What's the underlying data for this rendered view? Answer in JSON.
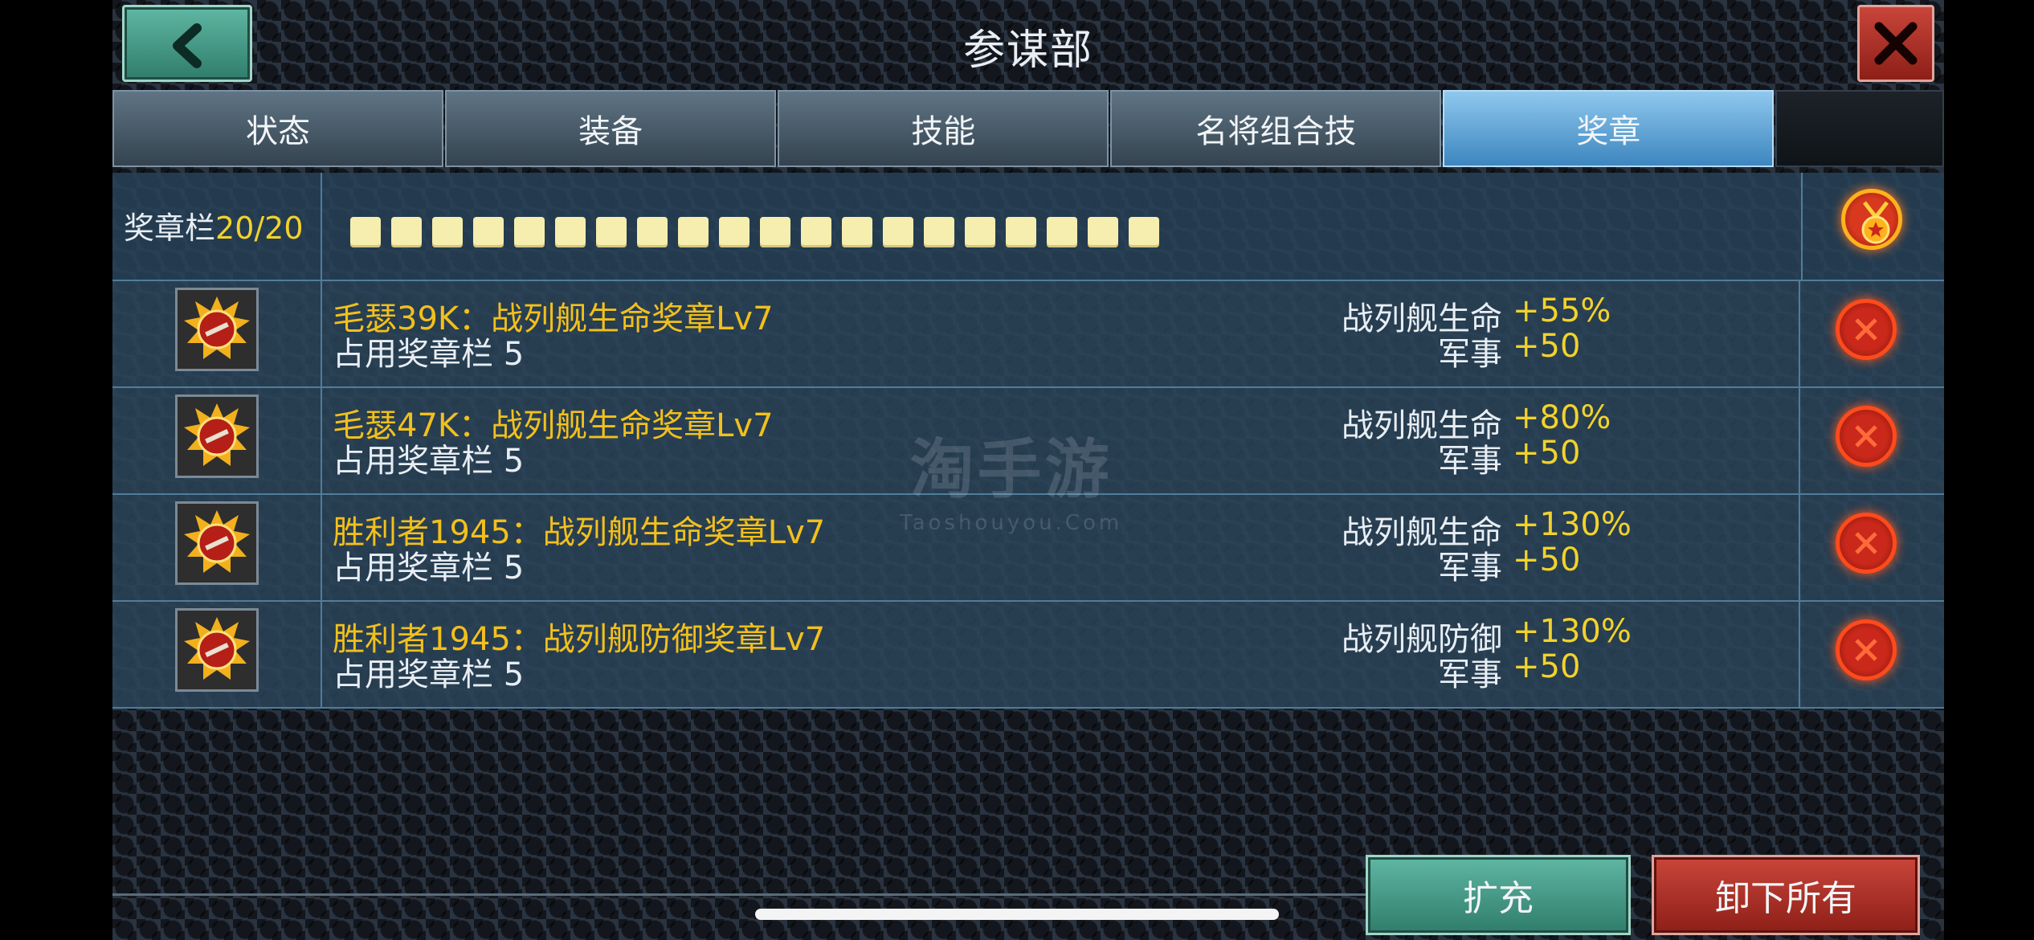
{
  "header": {
    "title": "参谋部",
    "back_icon": "chevron-left-icon",
    "close_icon": "close-icon"
  },
  "tabs": [
    {
      "label": "状态",
      "active": false
    },
    {
      "label": "装备",
      "active": false
    },
    {
      "label": "技能",
      "active": false
    },
    {
      "label": "名将组合技",
      "active": false
    },
    {
      "label": "奖章",
      "active": true
    }
  ],
  "slots": {
    "label": "奖章栏",
    "count": "20/20",
    "used": 20,
    "total": 20
  },
  "medals": [
    {
      "name": "毛瑟39K：战列舰生命奖章Lv7",
      "slots": "占用奖章栏 5",
      "stat1_label": "战列舰生命",
      "stat1_value": "+55%",
      "stat2_label": "军事",
      "stat2_value": "+50"
    },
    {
      "name": "毛瑟47K：战列舰生命奖章Lv7",
      "slots": "占用奖章栏 5",
      "stat1_label": "战列舰生命",
      "stat1_value": "+80%",
      "stat2_label": "军事",
      "stat2_value": "+50"
    },
    {
      "name": "胜利者1945：战列舰生命奖章Lv7",
      "slots": "占用奖章栏 5",
      "stat1_label": "战列舰生命",
      "stat1_value": "+130%",
      "stat2_label": "军事",
      "stat2_value": "+50"
    },
    {
      "name": "胜利者1945：战列舰防御奖章Lv7",
      "slots": "占用奖章栏 5",
      "stat1_label": "战列舰防御",
      "stat1_value": "+130%",
      "stat2_label": "军事",
      "stat2_value": "+50"
    }
  ],
  "watermark": {
    "cn": "淘手游",
    "en": "Taoshouyou.Com"
  },
  "footer": {
    "expand_label": "扩充",
    "unload_all_label": "卸下所有"
  },
  "colors": {
    "accent_yellow": "#f2d22b",
    "teal_button": "#3f9a85",
    "red_button": "#a8291f",
    "active_tab": "#5aa6dd"
  }
}
